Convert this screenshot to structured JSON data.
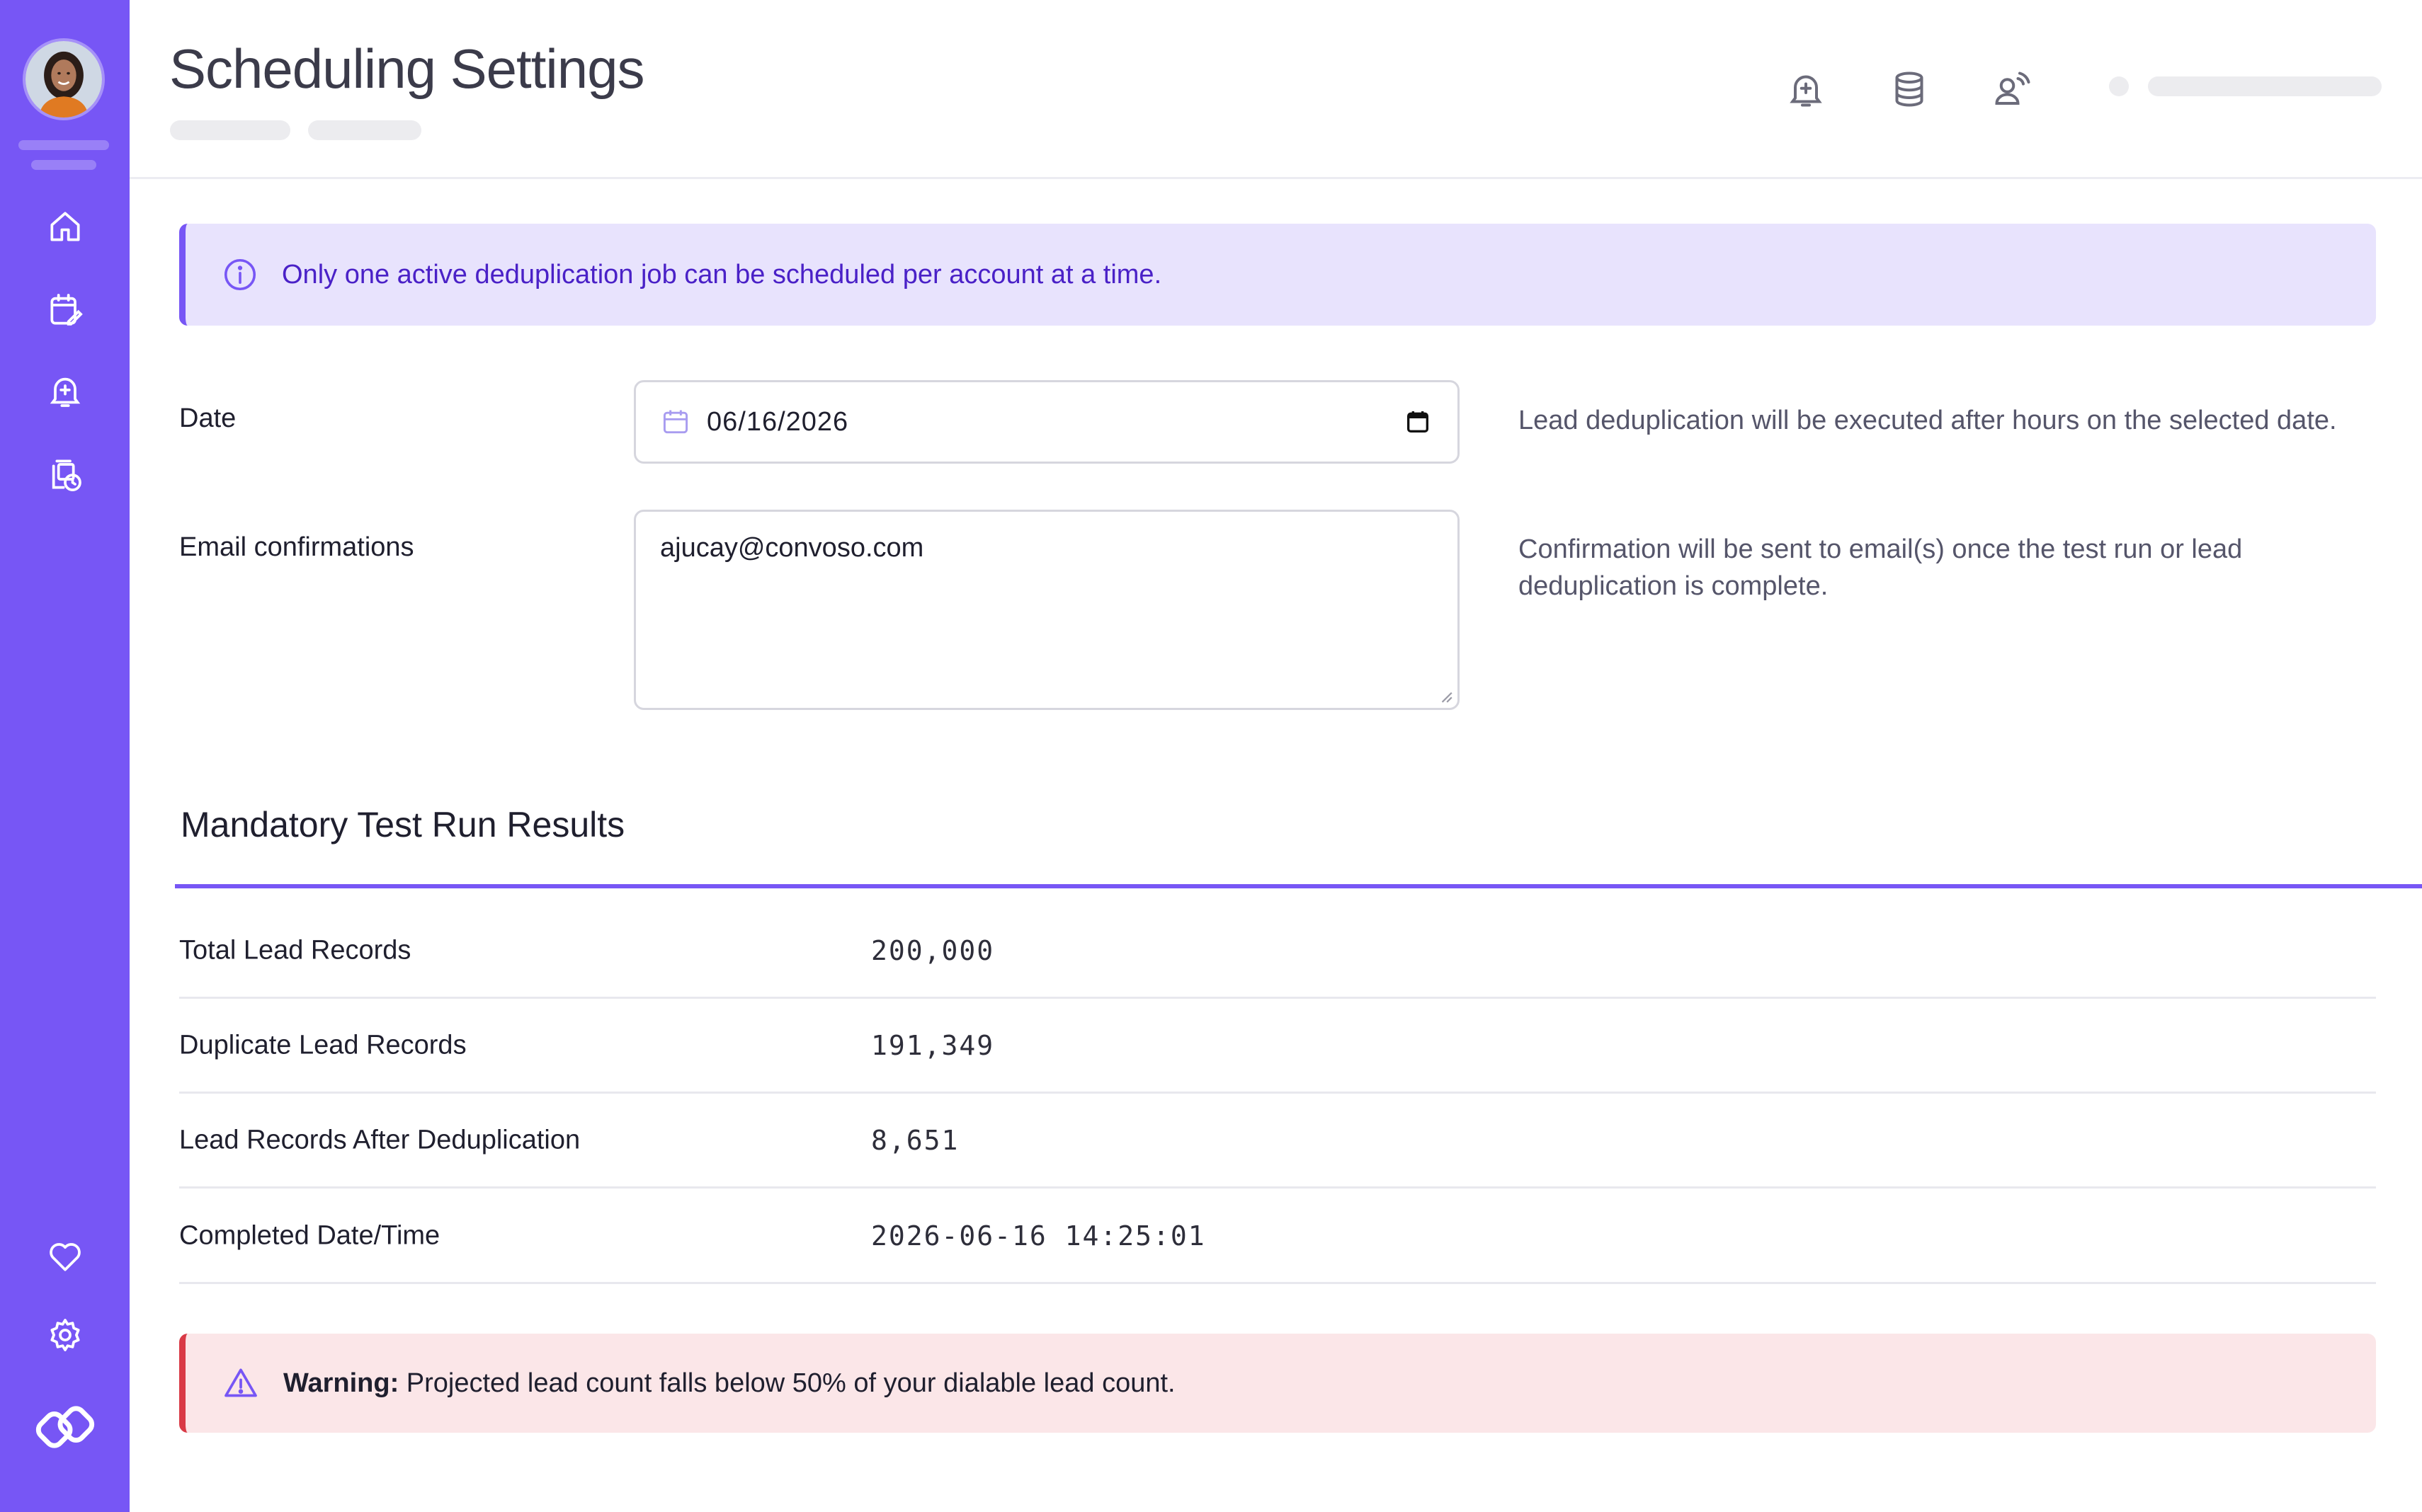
{
  "app": {
    "title": "Scheduling Settings"
  },
  "colors": {
    "brand": "#7756f5",
    "info_bg": "#e8e3fd",
    "info_text": "#4a21c7",
    "warning_bg": "#fbe6e8",
    "warning_accent": "#d93a46"
  },
  "sidebar": {
    "avatar_icon": "user-avatar",
    "nav_items": [
      {
        "icon": "home-icon"
      },
      {
        "icon": "calendar-edit-icon"
      },
      {
        "icon": "bell-plus-icon"
      },
      {
        "icon": "files-clock-icon"
      }
    ],
    "bottom_items": [
      {
        "icon": "heart-icon"
      },
      {
        "icon": "gear-icon"
      },
      {
        "icon": "app-logo-icon"
      }
    ]
  },
  "header": {
    "icons": [
      "bell-plus-icon",
      "database-icon",
      "user-signal-icon"
    ]
  },
  "info_banner": {
    "icon": "info-icon",
    "text": "Only one active deduplication job can be scheduled per account at a time."
  },
  "form": {
    "date": {
      "label": "Date",
      "value": "06/16/2026",
      "help": "Lead deduplication will be executed after hours on the selected date."
    },
    "email": {
      "label": "Email confirmations",
      "value": "ajucay@convoso.com",
      "help_line1": "Confirmation will be sent to email(s) once the test run or lead",
      "help_line2": "deduplication is complete."
    }
  },
  "results": {
    "title": "Mandatory Test Run Results",
    "rows": [
      {
        "label": "Total Lead Records",
        "value": "200,000"
      },
      {
        "label": "Duplicate Lead Records",
        "value": "191,349"
      },
      {
        "label": "Lead Records After Deduplication",
        "value": "8,651"
      },
      {
        "label": "Completed Date/Time",
        "value": "2026-06-16 14:25:01"
      }
    ]
  },
  "warning": {
    "icon": "warning-triangle-icon",
    "prefix": "Warning:",
    "text": " Projected lead count falls below 50% of your dialable lead count."
  }
}
